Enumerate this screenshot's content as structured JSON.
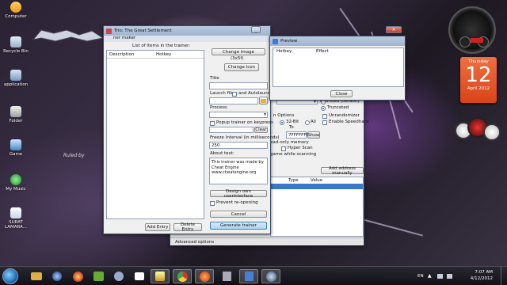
{
  "desktop": {
    "icons": [
      {
        "label": "Computer"
      },
      {
        "label": "Recycle Bin"
      },
      {
        "label": "application"
      },
      {
        "label": "Folder"
      },
      {
        "label": "Game"
      },
      {
        "label": "My Music"
      },
      {
        "label": "SURAT LAMARA..."
      }
    ],
    "overlay_text": "Ruled·by",
    "calendar": {
      "weekday": "Thursday",
      "day": "12",
      "month_year": "April 2012"
    }
  },
  "trainer_window": {
    "title": "Trio: The Great Settlement",
    "subtitle_tab": "ner maker",
    "list_title": "List of items in the trainer:",
    "columns": [
      "Description",
      "Hotkey"
    ],
    "add_entry": "Add Entry",
    "delete_entry": "Delete Entry",
    "change_image": "Change Image",
    "image_size": "(3x5f)",
    "change_icon": "Change Icon",
    "title_label": "Title",
    "launch_file_label": "Launch file:",
    "and_autolaunch": "and Autolaunch",
    "process_label": "Process:",
    "popup_on_keypress": "Popup trainer on keypress",
    "clear": "Clear",
    "freeze_interval_label": "Freeze Interval (in milliseconds)",
    "freeze_interval_value": "250",
    "about_text_label": "About text:",
    "about_text": "This trainer was made by Cheat Engine www.cheatengine.org",
    "design_own": "Design own userinterface",
    "prevent_reopening": "Prevent re-opening",
    "cancel": "Cancel",
    "generate": "Generate trainer"
  },
  "preview_window": {
    "title": "Preview",
    "columns": [
      "Hotkey",
      "Effect"
    ],
    "close": "Close"
  },
  "cheat_engine": {
    "rounded": "Rounded (default)",
    "truncated": "Truncated",
    "scan_options": "n Options",
    "bit32": "32-Bit",
    "all": "All",
    "to": "To",
    "to_value": "7FFFFFFF",
    "show": "Show",
    "read_only": "ead-only memory",
    "hyper_scan": "Hyper Scan",
    "game_while_scanning": "game while scanning",
    "unrandomizer": "Unrandomizer",
    "enable_speedhack": "Enable Speedhack",
    "add_address_manually": "Add address manually",
    "table_cols": [
      "Type",
      "Value"
    ],
    "advanced_options": "Advanced options"
  },
  "taskbar": {
    "items": [
      "folder",
      "media",
      "firefox",
      "um",
      "ce-running",
      "msg",
      "paint",
      "chrome",
      "app2",
      "disk",
      "cheat-engine"
    ],
    "lang": "EN",
    "time": "7:07 AM",
    "date": "4/12/2012"
  }
}
